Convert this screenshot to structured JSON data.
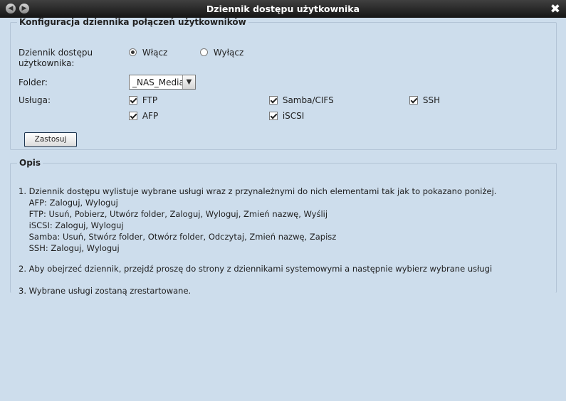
{
  "window": {
    "title": "Dziennik dostępu użytkownika",
    "back_icon": "◀",
    "forward_icon": "▶",
    "close_icon": "✖"
  },
  "config": {
    "legend": "Konfiguracja dziennika połączeń użytkowników",
    "log_label_line1": "Dziennik dostępu",
    "log_label_line2": "użytkownika:",
    "radio_on": "Włącz",
    "radio_off": "Wyłącz",
    "selected_radio": "on",
    "folder_label": "Folder:",
    "folder_value": "_NAS_Media",
    "service_label": "Usługa:",
    "services": [
      {
        "label": "FTP",
        "checked": true
      },
      {
        "label": "Samba/CIFS",
        "checked": true
      },
      {
        "label": "SSH",
        "checked": true
      },
      {
        "label": "AFP",
        "checked": true
      },
      {
        "label": "iSCSI",
        "checked": true
      }
    ],
    "apply_label": "Zastosuj"
  },
  "description": {
    "legend": "Opis",
    "lines": [
      "1. Dziennik dostępu wylistuje wybrane usługi wraz z przynależnymi do nich elementami tak jak to pokazano poniżej.",
      "    AFP: Zaloguj, Wyloguj",
      "    FTP: Usuń, Pobierz, Utwórz folder, Zaloguj, Wyloguj, Zmień nazwę, Wyślij",
      "    iSCSI: Zaloguj, Wyloguj",
      "    Samba: Usuń, Stwórz folder, Otwórz folder, Odczytaj, Zmień nazwę, Zapisz",
      "    SSH: Zaloguj, Wyloguj",
      "2. Aby obejrzeć dziennik, przejdź proszę do strony z dziennikami systemowymi a następnie wybierz wybrane usługi",
      "3. Wybrane usługi zostaną zrestartowane."
    ]
  }
}
